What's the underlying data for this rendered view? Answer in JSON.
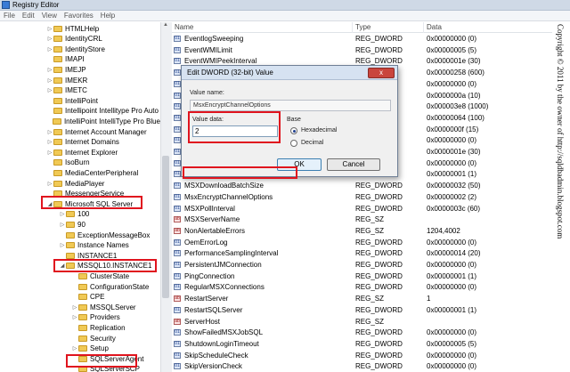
{
  "window": {
    "title": "Registry Editor"
  },
  "menu": [
    "File",
    "Edit",
    "View",
    "Favorites",
    "Help"
  ],
  "tree": {
    "items": [
      {
        "label": "HTMLHelp",
        "arrow": "▷",
        "indent": 1
      },
      {
        "label": "IdentityCRL",
        "arrow": "▷",
        "indent": 1
      },
      {
        "label": "IdentityStore",
        "arrow": "▷",
        "indent": 1
      },
      {
        "label": "IMAPI",
        "arrow": "",
        "indent": 1
      },
      {
        "label": "IMEJP",
        "arrow": "▷",
        "indent": 1
      },
      {
        "label": "IMEKR",
        "arrow": "▷",
        "indent": 1
      },
      {
        "label": "IMETC",
        "arrow": "▷",
        "indent": 1
      },
      {
        "label": "IntelliPoint",
        "arrow": "",
        "indent": 1
      },
      {
        "label": "Intellipoint Intellitype Pro Auto",
        "arrow": "",
        "indent": 1
      },
      {
        "label": "IntelliPoint IntelliType Pro Blue",
        "arrow": "",
        "indent": 1
      },
      {
        "label": "Internet Account Manager",
        "arrow": "▷",
        "indent": 1
      },
      {
        "label": "Internet Domains",
        "arrow": "▷",
        "indent": 1
      },
      {
        "label": "Internet Explorer",
        "arrow": "▷",
        "indent": 1
      },
      {
        "label": "IsoBurn",
        "arrow": "",
        "indent": 1
      },
      {
        "label": "MediaCenterPeripheral",
        "arrow": "",
        "indent": 1
      },
      {
        "label": "MediaPlayer",
        "arrow": "▷",
        "indent": 1
      },
      {
        "label": "MessengerService",
        "arrow": "",
        "indent": 1
      },
      {
        "label": "Microsoft SQL Server",
        "arrow": "◢",
        "indent": 1
      },
      {
        "label": "100",
        "arrow": "▷",
        "indent": 2
      },
      {
        "label": "90",
        "arrow": "▷",
        "indent": 2
      },
      {
        "label": "ExceptionMessageBox",
        "arrow": "",
        "indent": 2
      },
      {
        "label": "Instance Names",
        "arrow": "▷",
        "indent": 2
      },
      {
        "label": "INSTANCE1",
        "arrow": "",
        "indent": 2
      },
      {
        "label": "MSSQL10.INSTANCE1",
        "arrow": "◢",
        "indent": 2
      },
      {
        "label": "ClusterState",
        "arrow": "",
        "indent": 3
      },
      {
        "label": "ConfigurationState",
        "arrow": "",
        "indent": 3
      },
      {
        "label": "CPE",
        "arrow": "",
        "indent": 3
      },
      {
        "label": "MSSQLServer",
        "arrow": "▷",
        "indent": 3
      },
      {
        "label": "Providers",
        "arrow": "▷",
        "indent": 3
      },
      {
        "label": "Replication",
        "arrow": "",
        "indent": 3
      },
      {
        "label": "Security",
        "arrow": "",
        "indent": 3
      },
      {
        "label": "Setup",
        "arrow": "▷",
        "indent": 3
      },
      {
        "label": "SQLServerAgent",
        "arrow": "",
        "indent": 3
      },
      {
        "label": "SQLServerSCP",
        "arrow": "",
        "indent": 3
      }
    ]
  },
  "list": {
    "headers": {
      "name": "Name",
      "type": "Type",
      "data": "Data"
    },
    "rows": [
      {
        "name": "EventlogSweeping",
        "type": "REG_DWORD",
        "data": "0x00000000 (0)",
        "kind": "dword"
      },
      {
        "name": "EventWMILimit",
        "type": "REG_DWORD",
        "data": "0x00000005 (5)",
        "kind": "dword"
      },
      {
        "name": "EventWMIPeekInterval",
        "type": "REG_DWORD",
        "data": "0x0000001e (30)",
        "kind": "dword"
      },
      {
        "name": "",
        "type": "",
        "data": "0x00000258 (600)",
        "kind": "dword"
      },
      {
        "name": "",
        "type": "",
        "data": "0x00000000 (0)",
        "kind": "dword"
      },
      {
        "name": "",
        "type": "",
        "data": "0x0000000a (10)",
        "kind": "dword"
      },
      {
        "name": "",
        "type": "",
        "data": "0x000003e8 (1000)",
        "kind": "dword"
      },
      {
        "name": "",
        "type": "",
        "data": "0x00000064 (100)",
        "kind": "dword"
      },
      {
        "name": "",
        "type": "",
        "data": "0x0000000f (15)",
        "kind": "dword"
      },
      {
        "name": "",
        "type": "",
        "data": "0x00000000 (0)",
        "kind": "dword"
      },
      {
        "name": "",
        "type": "",
        "data": "0x0000001e (30)",
        "kind": "dword"
      },
      {
        "name": "",
        "type": "",
        "data": "0x00000000 (0)",
        "kind": "dword"
      },
      {
        "name": "",
        "type": "",
        "data": "0x00000001 (1)",
        "kind": "dword"
      },
      {
        "name": "MSXDownloadBatchSize",
        "type": "REG_DWORD",
        "data": "0x00000032 (50)",
        "kind": "dword"
      },
      {
        "name": "MsxEncryptChannelOptions",
        "type": "REG_DWORD",
        "data": "0x00000002 (2)",
        "kind": "dword"
      },
      {
        "name": "MSXPollInterval",
        "type": "REG_DWORD",
        "data": "0x0000003c (60)",
        "kind": "dword"
      },
      {
        "name": "MSXServerName",
        "type": "REG_SZ",
        "data": "",
        "kind": "string"
      },
      {
        "name": "NonAlertableErrors",
        "type": "REG_SZ",
        "data": "1204,4002",
        "kind": "string"
      },
      {
        "name": "OemErrorLog",
        "type": "REG_DWORD",
        "data": "0x00000000 (0)",
        "kind": "dword"
      },
      {
        "name": "PerformanceSamplingInterval",
        "type": "REG_DWORD",
        "data": "0x00000014 (20)",
        "kind": "dword"
      },
      {
        "name": "PersistentJMConnection",
        "type": "REG_DWORD",
        "data": "0x00000000 (0)",
        "kind": "dword"
      },
      {
        "name": "PingConnection",
        "type": "REG_DWORD",
        "data": "0x00000001 (1)",
        "kind": "dword"
      },
      {
        "name": "RegularMSXConnections",
        "type": "REG_DWORD",
        "data": "0x00000000 (0)",
        "kind": "dword"
      },
      {
        "name": "RestartServer",
        "type": "REG_SZ",
        "data": "1",
        "kind": "string"
      },
      {
        "name": "RestartSQLServer",
        "type": "REG_DWORD",
        "data": "0x00000001 (1)",
        "kind": "dword"
      },
      {
        "name": "ServerHost",
        "type": "REG_SZ",
        "data": "",
        "kind": "string"
      },
      {
        "name": "ShowFailedMSXJobSQL",
        "type": "REG_DWORD",
        "data": "0x00000000 (0)",
        "kind": "dword"
      },
      {
        "name": "ShutdownLoginTimeout",
        "type": "REG_DWORD",
        "data": "0x00000005 (5)",
        "kind": "dword"
      },
      {
        "name": "SkipScheduleCheck",
        "type": "REG_DWORD",
        "data": "0x00000000 (0)",
        "kind": "dword"
      },
      {
        "name": "SkipVersionCheck",
        "type": "REG_DWORD",
        "data": "0x00000000 (0)",
        "kind": "dword"
      }
    ]
  },
  "dialog": {
    "title": "Edit DWORD (32-bit) Value",
    "close_label": "x",
    "value_name_label": "Value name:",
    "value_name": "MsxEncryptChannelOptions",
    "value_data_label": "Value data:",
    "value_data": "2",
    "base_label": "Base",
    "hex_label": "Hexadecimal",
    "dec_label": "Decimal",
    "selected_base": "Hexadecimal",
    "ok_label": "OK",
    "cancel_label": "Cancel"
  },
  "watermark": "Copyright © 2011 by the owner of http://sqldbadmin.blogspot.com"
}
